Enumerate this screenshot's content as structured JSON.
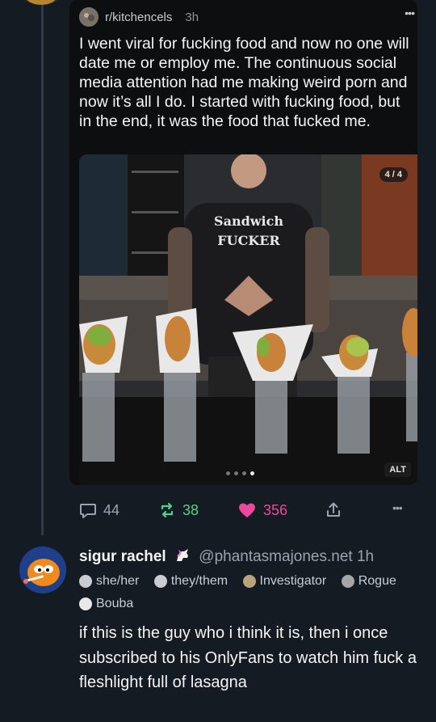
{
  "original_post": {
    "subreddit": "r/kitchencels",
    "time": "3h",
    "text": "I went viral for fucking food and now no one will date me or employ me. The continuous social media attention had me making weird porn and now it’s all I do. I started with fucking food, but in the end, it was the food that fucked me.",
    "media": {
      "page_indicator": "4 / 4",
      "alt_label": "ALT",
      "shirt_line1": "Sandwich",
      "shirt_line2": "FUCKER"
    }
  },
  "actions": {
    "replies": "44",
    "reposts": "38",
    "likes": "356"
  },
  "colors": {
    "background": "#151b23",
    "repost": "#4fd18b",
    "like": "#ec4899",
    "muted": "#9aa3ae"
  },
  "reply": {
    "display_name": "sigur rachel",
    "handle": "@phantasmajones.net",
    "time": "1h",
    "tags": [
      {
        "label": "she/her",
        "icon": "pronoun-icon"
      },
      {
        "label": "they/them",
        "icon": "pronoun-icon"
      },
      {
        "label": "Investigator",
        "icon": "investigator-icon"
      },
      {
        "label": "Rogue",
        "icon": "rogue-icon"
      },
      {
        "label": "Bouba",
        "icon": "bouba-icon"
      }
    ],
    "text": "if this is the guy who i think it is, then i once subscribed to his OnlyFans to watch him fuck a fleshlight full of lasagna"
  }
}
